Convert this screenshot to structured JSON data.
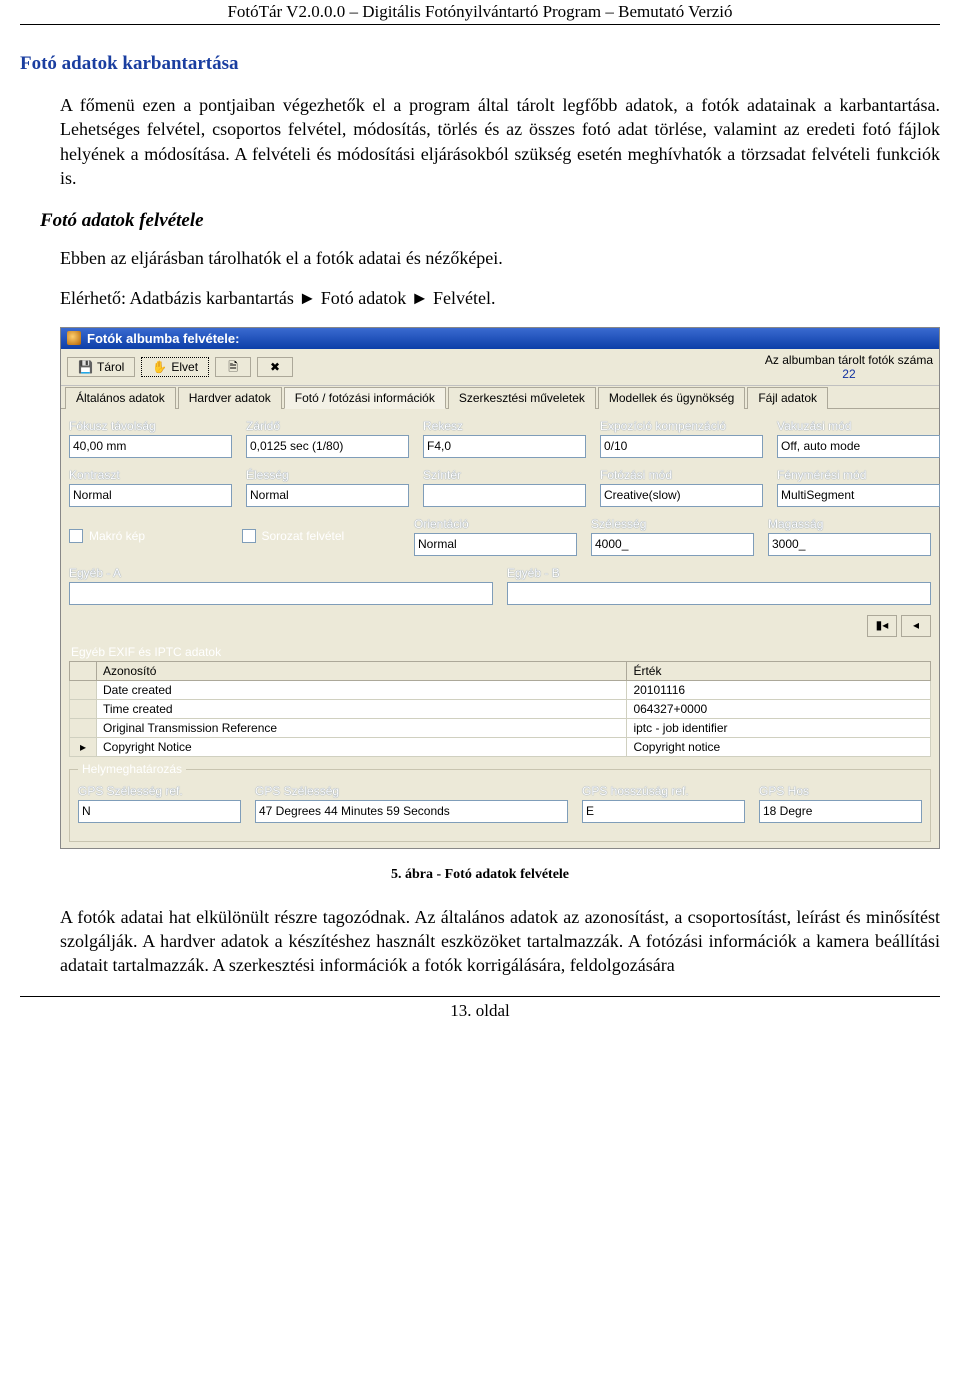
{
  "doc": {
    "header": "FotóTár V2.0.0.0 – Digitális Fotónyilvántartó Program – Bemutató Verzió",
    "section_title": "Fotó adatok karbantartása",
    "para1": "A főmenü ezen a pontjaiban végezhetők el a program által tárolt legfőbb adatok, a fotók adatainak a karbantartása. Lehetséges felvétel, csoportos felvétel, módosítás, törlés és az összes fotó adat törlése, valamint az eredeti fotó fájlok helyének a módosítása. A felvételi és módosítási eljárásokból szükség esetén meghívhatók a törzsadat felvételi funkciók is.",
    "subheading": "Fotó adatok felvétele",
    "para2": "Ebben az eljárásban tárolhatók el a fotók adatai és nézőképei.",
    "para3": "Elérhető: Adatbázis karbantartás ► Fotó adatok ► Felvétel.",
    "caption": "5. ábra - Fotó adatok felvétele",
    "para4": "A fotók adatai hat elkülönült részre tagozódnak. Az általános adatok az azonosítást, a csoportosítást, leírást és minősítést szolgálják. A hardver adatok a készítéshez használt eszközöket tartalmazzák. A fotózási információk a kamera beállítási adatait tartalmazzák. A szerkesztési információk a fotók korrigálására, feldolgozására",
    "footer": "13. oldal"
  },
  "win": {
    "title": "Fotók albumba felvétele:",
    "toolbar": {
      "tarol": "Tárol",
      "elvet": "Elvet",
      "count_label": "Az albumban tárolt fotók száma",
      "count_value": "22"
    },
    "tabs": [
      "Általános adatok",
      "Hardver adatok",
      "Fotó / fotózási információk",
      "Szerkesztési műveletek",
      "Modellek és ügynökség",
      "Fájl adatok"
    ],
    "active_tab": 2,
    "row1": {
      "fokusz_l": "Fókusz távolság",
      "fokusz_v": "40,00 mm",
      "zarido_l": "Záridő",
      "zarido_v": "0,0125 sec (1/80)",
      "rekesz_l": "Rekesz",
      "rekesz_v": "F4,0",
      "expo_l": "Expozíció kompenzáció",
      "expo_v": "0/10",
      "vaku_l": "Vakuzási mód",
      "vaku_v": "Off, auto mode"
    },
    "row2": {
      "kontraszt_l": "Kontraszt",
      "kontraszt_v": "Normal",
      "elesseg_l": "Élesség",
      "elesseg_v": "Normal",
      "szinter_l": "Színtér",
      "szinter_v": "",
      "fotomod_l": "Fotózási mód",
      "fotomod_v": "Creative(slow)",
      "fenym_l": "Fénymérési mód",
      "fenym_v": "MultiSegment"
    },
    "row3": {
      "makro": "Makró kép",
      "sorozat": "Sorozat felvétel",
      "orient_l": "Orientáció",
      "orient_v": "Normal",
      "szel_l": "Szélesség",
      "szel_v": "4000_",
      "mag_l": "Magasság",
      "mag_v": "3000_"
    },
    "egyeb_a": "Egyéb - A",
    "egyeb_b": "Egyéb - B",
    "exif_caption": "Egyéb EXIF és IPTC adatok",
    "exif_headers": {
      "id": "Azonosító",
      "val": "Érték"
    },
    "exif_rows": [
      {
        "id": "Date created",
        "val": "20101116"
      },
      {
        "id": "Time created",
        "val": "064327+0000"
      },
      {
        "id": "Original Transmission Reference",
        "val": "iptc - job identifier"
      },
      {
        "id": "Copyright Notice",
        "val": "Copyright notice"
      }
    ],
    "geo": {
      "legend": "Helymeghatározás",
      "latref_l": "GPS Szélesség ref.",
      "latref_v": "N",
      "lat_l": "GPS Szélesség",
      "lat_v": "47 Degrees 44 Minutes 59 Seconds",
      "lonref_l": "GPS hosszúság ref.",
      "lonref_v": "E",
      "lon_l": "GPS Hos",
      "lon_v": "18 Degre"
    }
  }
}
